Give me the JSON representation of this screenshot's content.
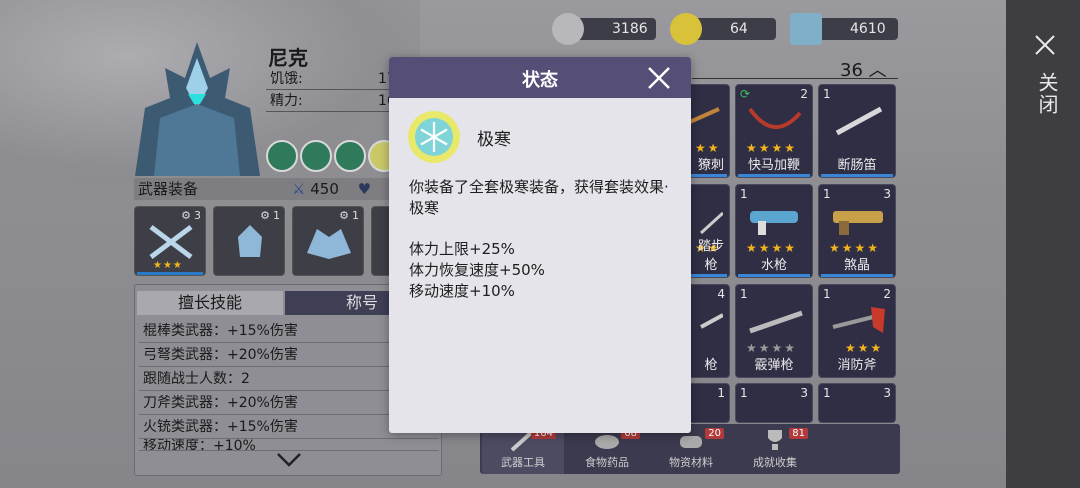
{
  "close_strip": {
    "label": "关闭"
  },
  "character": {
    "name": "尼克",
    "stats": [
      {
        "label": "饥饿:",
        "value": "17"
      },
      {
        "label": "精力:",
        "value": "16"
      }
    ],
    "weapon_section": "武器装备",
    "power": "450",
    "equipment": [
      {
        "level": "3",
        "stars": "★★★"
      },
      {
        "level": "1",
        "stars": ""
      },
      {
        "level": "1",
        "stars": ""
      }
    ]
  },
  "skills": {
    "tab_active": "擅长技能",
    "tab_other": "称号",
    "rows": [
      "棍棒类武器：+15%伤害",
      "弓弩类武器：+20%伤害",
      "跟随战士人数：2",
      "刀斧类武器：+20%伤害",
      "火铳类武器：+15%伤害",
      "移动速度：+10%"
    ]
  },
  "currencies": [
    {
      "name": "silver-coins",
      "value": "3186"
    },
    {
      "name": "gold-coin",
      "value": "64"
    },
    {
      "name": "tickets",
      "value": "4610"
    }
  ],
  "inventory_count": "36",
  "items": [
    {
      "qty": "",
      "level": "",
      "stars": "★★",
      "name": "獠刺"
    },
    {
      "qty": "",
      "level": "2",
      "stars": "★★★★",
      "name": "快马加鞭"
    },
    {
      "qty": "1",
      "level": "",
      "stars": "",
      "name": "断肠笛"
    },
    {
      "qty": "",
      "level": "",
      "stars": "★★",
      "name": "踏步枪"
    },
    {
      "qty": "1",
      "level": "",
      "stars": "★★★★",
      "name": "水枪"
    },
    {
      "qty": "1",
      "level": "3",
      "stars": "★★★★",
      "name": "煞晶"
    },
    {
      "qty": "",
      "level": "4",
      "stars": "",
      "name": "枪"
    },
    {
      "qty": "1",
      "level": "",
      "stars": "★★★★",
      "name": "霰弹枪"
    },
    {
      "qty": "1",
      "level": "2",
      "stars": "★★★",
      "name": "消防斧"
    },
    {
      "qty": "",
      "level": "1",
      "stars": "",
      "name": ""
    },
    {
      "qty": "1",
      "level": "3",
      "stars": "",
      "name": ""
    },
    {
      "qty": "1",
      "level": "3",
      "stars": "",
      "name": ""
    }
  ],
  "bottom_tabs": [
    {
      "label": "武器工具",
      "badge": "164"
    },
    {
      "label": "食物药品",
      "badge": "68"
    },
    {
      "label": "物资材料",
      "badge": "20"
    },
    {
      "label": "成就收集",
      "badge": "81"
    }
  ],
  "modal": {
    "title": "状态",
    "effect_name": "极寒",
    "description": "你装备了全套极寒装备，获得套装效果·极寒",
    "bonuses": [
      "体力上限+25%",
      "体力恢复速度+50%",
      "移动速度+10%"
    ]
  },
  "colors": {
    "modal_header": "#554e76",
    "modal_body": "#e4e4ea",
    "star": "#f0b41e",
    "item_bg": "#2f2e45"
  }
}
